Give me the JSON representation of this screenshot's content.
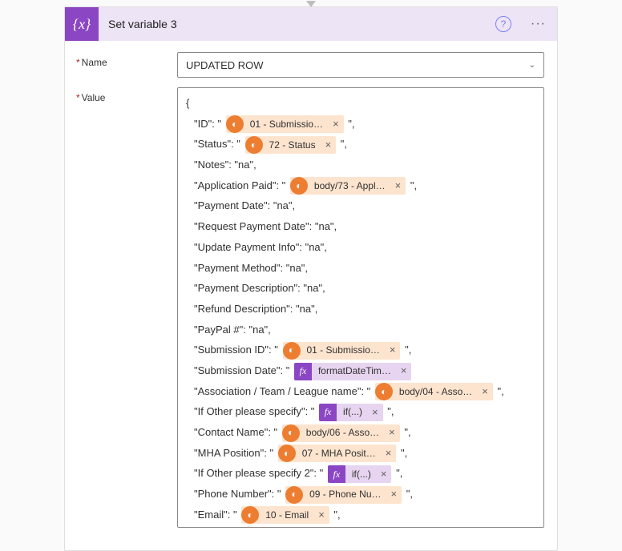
{
  "header": {
    "icon_label": "{x}",
    "title": "Set variable 3",
    "help": "?",
    "more": "···"
  },
  "fields": {
    "name_label": "Name",
    "value_label": "Value",
    "name_value": "UPDATED ROW"
  },
  "json_open": "{",
  "lines": [
    {
      "key": "ID",
      "pre": "\"ID\": \" ",
      "token": {
        "type": "dyn",
        "label": "01 - Submissio…"
      },
      "post": " \","
    },
    {
      "key": "Status",
      "pre": "\"Status\": \" ",
      "token": {
        "type": "dyn",
        "label": "72 - Status"
      },
      "post": " \","
    },
    {
      "key": "Notes",
      "plain": "\"Notes\": \"na\","
    },
    {
      "key": "Application Paid",
      "pre": "\"Application Paid\": \" ",
      "token": {
        "type": "dyn",
        "label": "body/73 - Appl…"
      },
      "post": " \","
    },
    {
      "key": "Payment Date",
      "plain": "\"Payment Date\": \"na\","
    },
    {
      "key": "Request Payment Date",
      "plain": "\"Request Payment Date\": \"na\","
    },
    {
      "key": "Update Payment Info",
      "plain": "\"Update Payment Info\": \"na\","
    },
    {
      "key": "Payment Method",
      "plain": "\"Payment Method\": \"na\","
    },
    {
      "key": "Payment Description",
      "plain": "\"Payment Description\": \"na\","
    },
    {
      "key": "Refund Description",
      "plain": "\"Refund Description\": \"na\","
    },
    {
      "key": "PayPal #",
      "plain": "\"PayPal #\": \"na\","
    },
    {
      "key": "Submission ID",
      "pre": "\"Submission ID\": \" ",
      "token": {
        "type": "dyn",
        "label": "01 - Submissio…"
      },
      "post": " \","
    },
    {
      "key": "Submission Date",
      "pre": "\"Submission Date\": \" ",
      "token": {
        "type": "fx",
        "label": "formatDateTim…"
      },
      "post": ""
    },
    {
      "key": "Association",
      "pre": "\"Association / Team / League name\": \" ",
      "token": {
        "type": "dyn",
        "label": "body/04 - Asso…"
      },
      "post": " \","
    },
    {
      "key": "If Other",
      "pre": "\"If Other please specify\": \" ",
      "token": {
        "type": "fx",
        "label": "if(...)"
      },
      "post": " \","
    },
    {
      "key": "Contact Name",
      "pre": "\"Contact Name\": \" ",
      "token": {
        "type": "dyn",
        "label": "body/06 - Asso…"
      },
      "post": " \","
    },
    {
      "key": "MHA Position",
      "pre": "\"MHA Position\": \" ",
      "token": {
        "type": "dyn",
        "label": "07 - MHA Posit…"
      },
      "post": " \","
    },
    {
      "key": "If Other 2",
      "pre": "\"If Other please specify 2\": \" ",
      "token": {
        "type": "fx",
        "label": "if(...)"
      },
      "post": " \","
    },
    {
      "key": "Phone Number",
      "pre": "\"Phone Number\": \" ",
      "token": {
        "type": "dyn",
        "label": "09 - Phone Nu…"
      },
      "post": " \","
    },
    {
      "key": "Email",
      "pre": "\"Email\": \" ",
      "token": {
        "type": "dyn",
        "label": "10 - Email"
      },
      "post": " \","
    }
  ]
}
